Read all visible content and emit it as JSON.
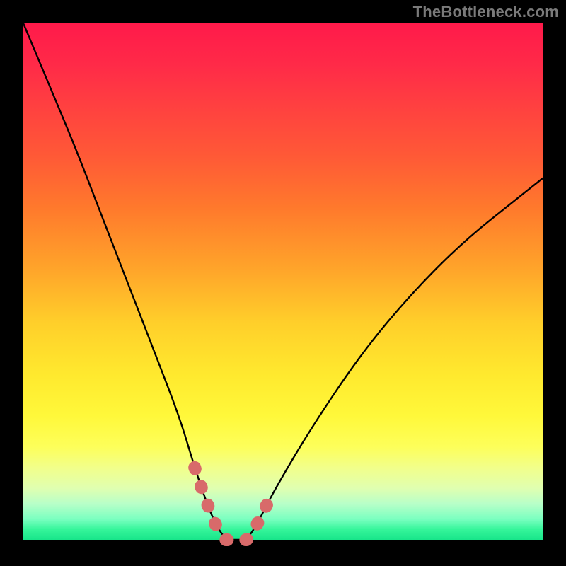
{
  "watermark": "TheBottleneck.com",
  "chart_data": {
    "type": "line",
    "title": "",
    "xlabel": "",
    "ylabel": "",
    "xlim": [
      0,
      100
    ],
    "ylim": [
      0,
      100
    ],
    "grid": false,
    "legend": false,
    "background": {
      "gradient_direction": "vertical",
      "top_color": "#ff1a4a",
      "mid_color": "#ffe92e",
      "bottom_color": "#18e58a",
      "meaning": "top=high bottleneck, bottom=low bottleneck"
    },
    "series": [
      {
        "name": "bottleneck-curve",
        "color": "#000000",
        "x": [
          0,
          5,
          10,
          15,
          20,
          25,
          30,
          33,
          35,
          37,
          39,
          41,
          43,
          45,
          48,
          55,
          65,
          75,
          85,
          95,
          100
        ],
        "y": [
          100,
          88,
          76,
          63,
          50,
          37,
          24,
          14,
          8,
          3,
          0,
          0,
          0,
          3,
          9,
          21,
          36,
          48,
          58,
          66,
          70
        ]
      },
      {
        "name": "highlight-segment",
        "color": "#d86a6a",
        "style": "thick-dotted",
        "x": [
          33,
          35,
          37,
          39,
          41,
          43,
          45,
          48
        ],
        "y": [
          14,
          8,
          3,
          0,
          0,
          0,
          3,
          9
        ]
      }
    ]
  }
}
